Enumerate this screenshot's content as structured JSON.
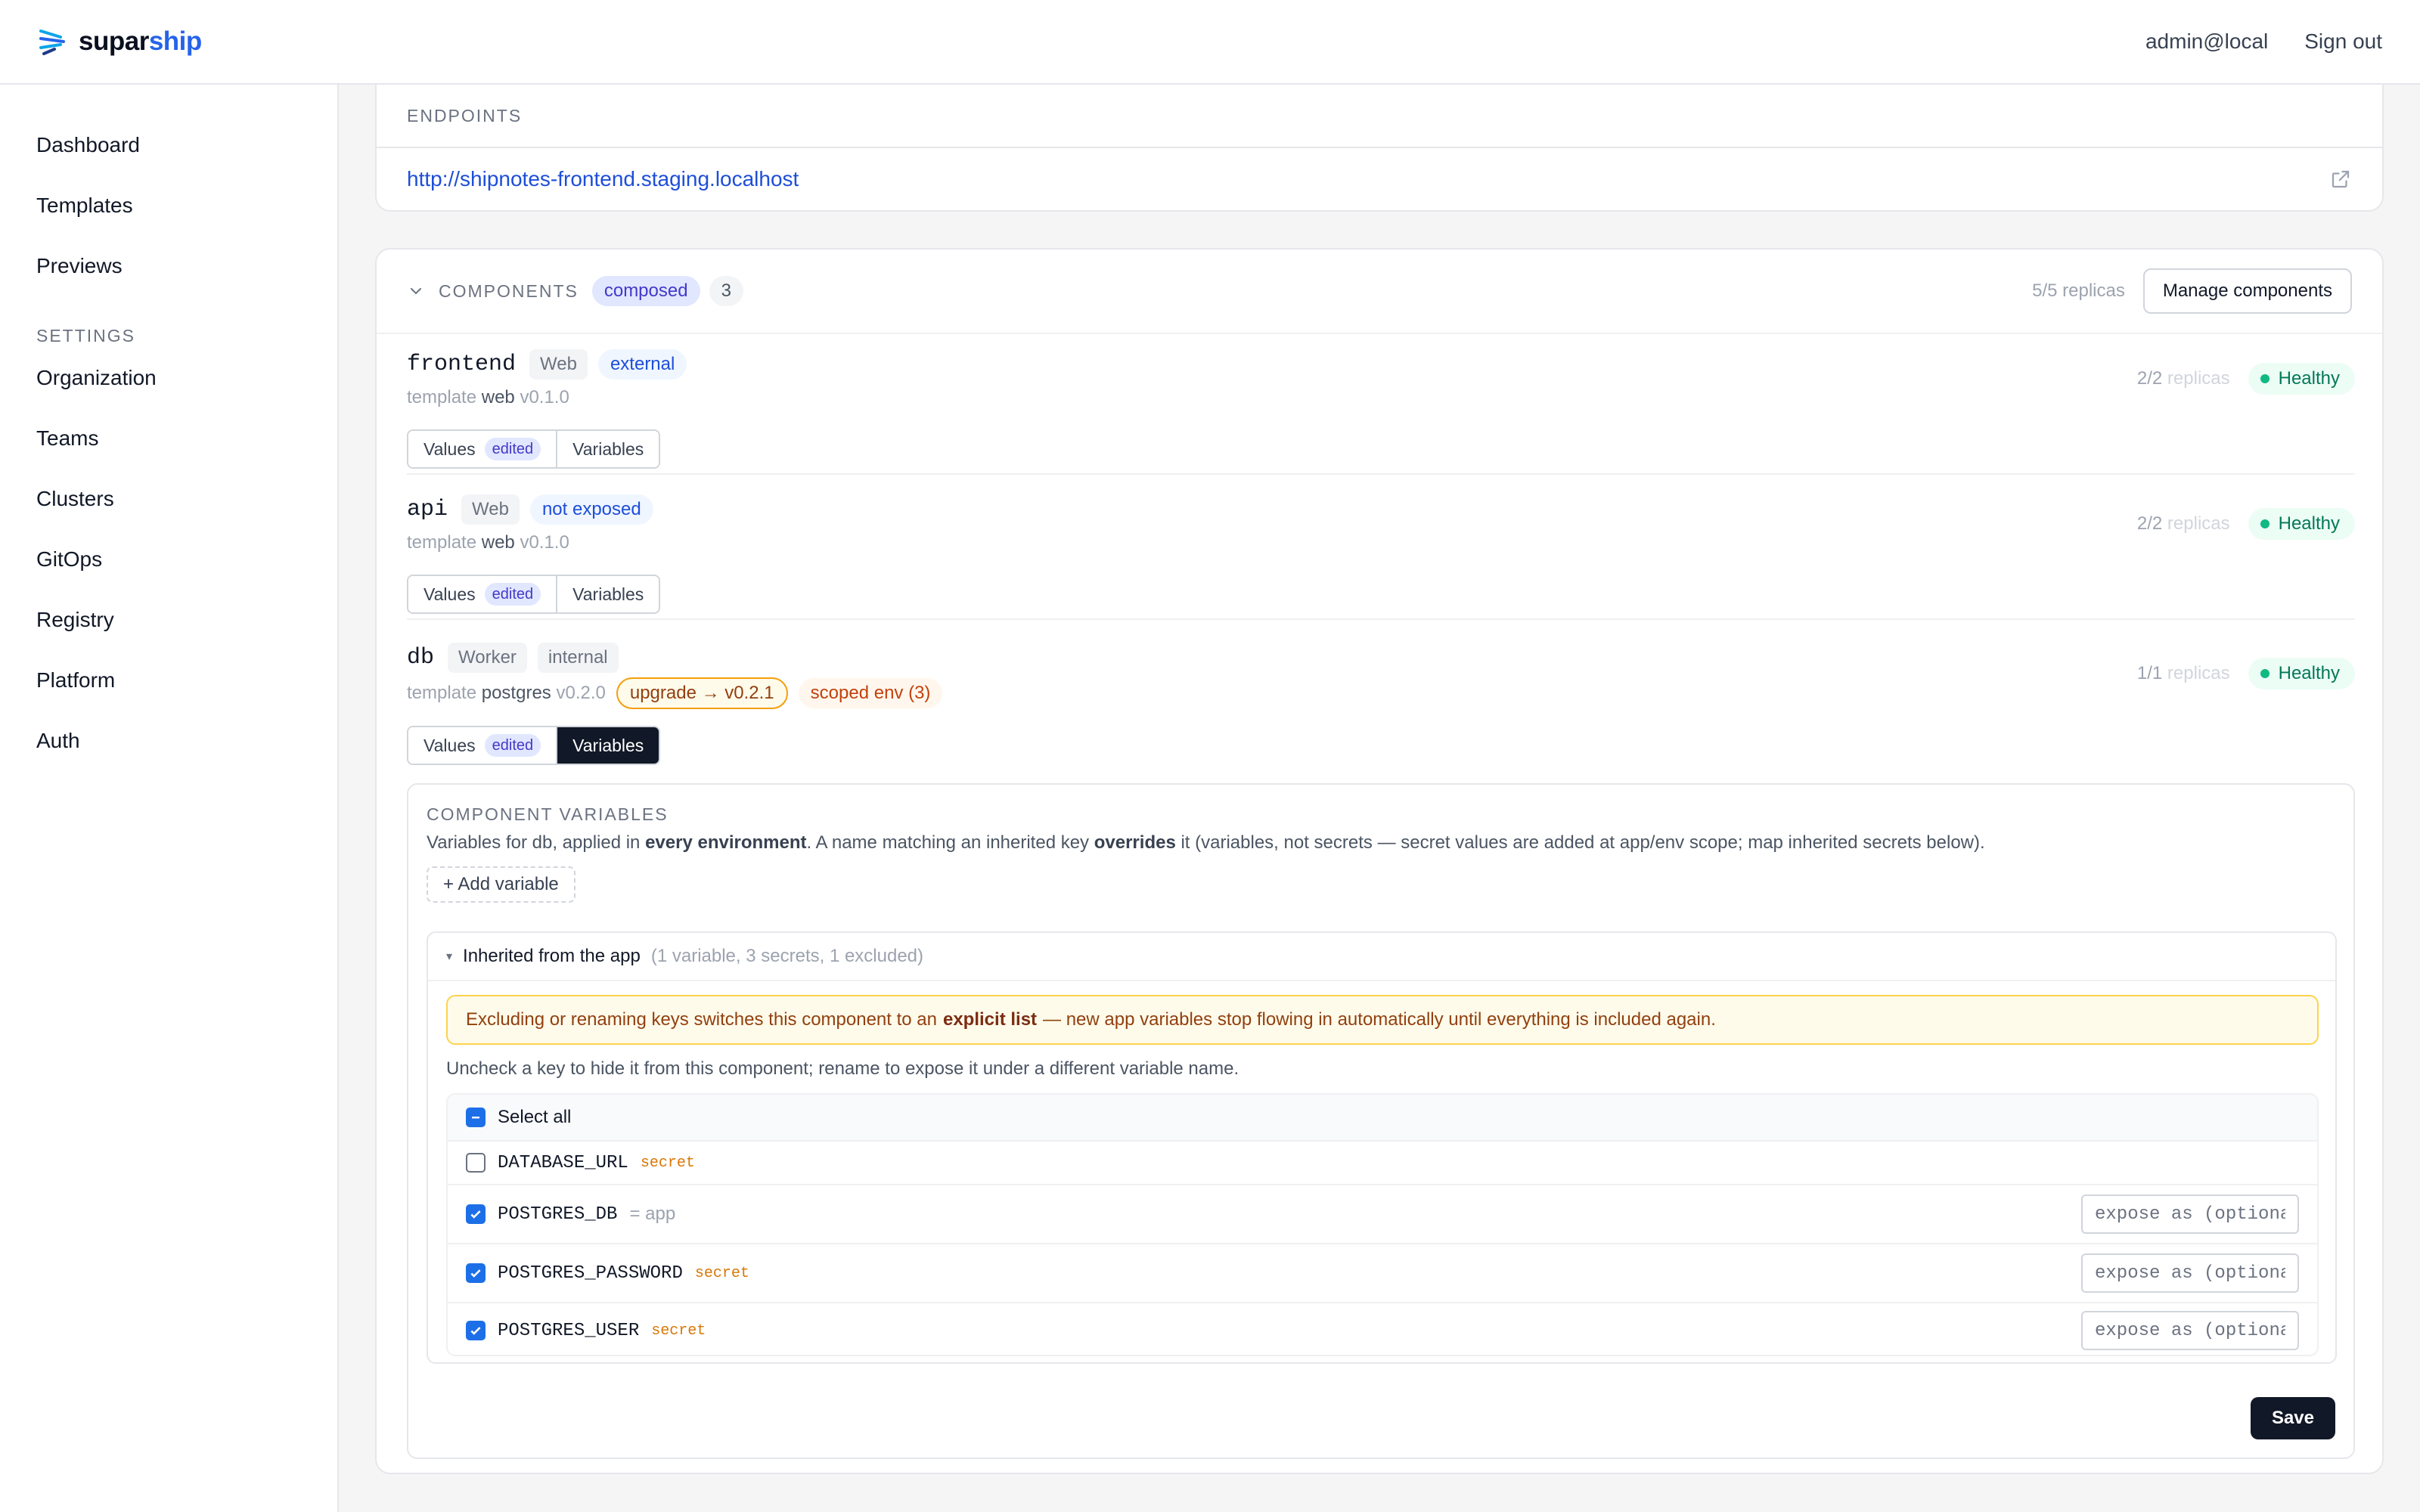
{
  "brand": {
    "prefix": "supar",
    "accent": "ship",
    "accent_color": "#2563eb"
  },
  "header": {
    "user": "admin@local",
    "signout": "Sign out"
  },
  "sidebar": {
    "items": [
      "Dashboard",
      "Templates",
      "Previews"
    ],
    "settings_heading": "SETTINGS",
    "settings_items": [
      "Organization",
      "Teams",
      "Clusters",
      "GitOps",
      "Registry",
      "Platform",
      "Auth"
    ]
  },
  "endpoints": {
    "heading": "ENDPOINTS",
    "url": "http://shipnotes-frontend.staging.localhost",
    "icon": "external-link-icon"
  },
  "components": {
    "heading": "COMPONENTS",
    "mode_badge": "composed",
    "count": "3",
    "replicas_total": "5/5 replicas",
    "manage_button": "Manage components",
    "items": [
      {
        "name": "frontend",
        "kind": "Web",
        "exposure": "external",
        "template_label": "template",
        "template_name": "web",
        "template_version": "v0.1.0",
        "replicas": "2/2",
        "replicas_label": "replicas",
        "status": "Healthy",
        "values_tab": "Values",
        "edited_badge": "edited",
        "variables_tab": "Variables"
      },
      {
        "name": "api",
        "kind": "Web",
        "exposure": "not exposed",
        "template_label": "template",
        "template_name": "web",
        "template_version": "v0.1.0",
        "replicas": "2/2",
        "replicas_label": "replicas",
        "status": "Healthy",
        "values_tab": "Values",
        "edited_badge": "edited",
        "variables_tab": "Variables"
      },
      {
        "name": "db",
        "kind": "Worker",
        "exposure": "internal",
        "template_label": "template",
        "template_name": "postgres",
        "template_version": "v0.2.0",
        "upgrade_badge": "upgrade → v0.2.1",
        "scoped_env_badge": "scoped env (3)",
        "replicas": "1/1",
        "replicas_label": "replicas",
        "status": "Healthy",
        "values_tab": "Values",
        "edited_badge": "edited",
        "variables_tab": "Variables"
      }
    ]
  },
  "variables_panel": {
    "title": "COMPONENT VARIABLES",
    "desc_1": "Variables for db, applied in",
    "desc_bold_1": "every environment",
    "desc_2": ". A name matching an inherited key",
    "desc_bold_2": "overrides",
    "desc_3": "it (variables, not secrets — secret values are added at app/env scope; map inherited secrets below).",
    "add_button": "+ Add variable",
    "inherited": {
      "toggle": "▾",
      "title": "Inherited from the app",
      "summary": "(1 variable, 3 secrets, 1 excluded)",
      "warning_1": "Excluding or renaming keys switches this component to an",
      "warning_bold": "explicit list",
      "warning_2": "— new app variables stop flowing in automatically until everything is included again.",
      "note": "Uncheck a key to hide it from this component; rename to expose it under a different variable name.",
      "select_all": "Select all",
      "keys": [
        {
          "name": "DATABASE_URL",
          "tag": "secret",
          "checked": false
        },
        {
          "name": "POSTGRES_DB",
          "eq": "= app",
          "checked": true,
          "placeholder": "expose as (optional)"
        },
        {
          "name": "POSTGRES_PASSWORD",
          "tag": "secret",
          "checked": true,
          "placeholder": "expose as (optional)"
        },
        {
          "name": "POSTGRES_USER",
          "tag": "secret",
          "checked": true,
          "placeholder": "expose as (optional)"
        }
      ]
    },
    "save": "Save"
  }
}
